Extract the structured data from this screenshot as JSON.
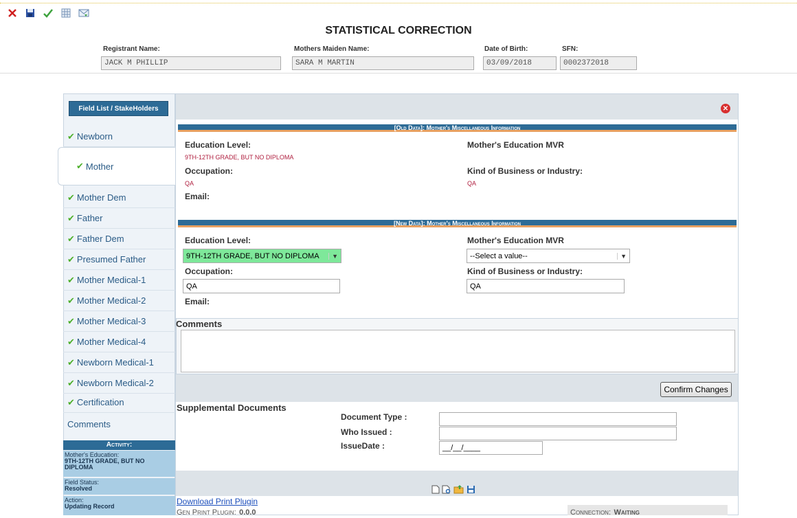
{
  "toolbar": {
    "icons": [
      "close-icon",
      "save-icon",
      "check-icon",
      "grid-icon",
      "email-icon"
    ]
  },
  "page_title": "STATISTICAL CORRECTION",
  "header": {
    "registrant_label": "Registrant Name:",
    "registrant_value": "JACK M PHILLIP",
    "maiden_label": "Mothers Maiden Name:",
    "maiden_value": "SARA M MARTIN",
    "dob_label": "Date of Birth:",
    "dob_value": "03/09/2018",
    "sfn_label": "SFN:",
    "sfn_value": "0002372018"
  },
  "sidebar": {
    "field_list_button": "Field List / StakeHolders",
    "items": [
      {
        "label": "Newborn",
        "checked": true
      },
      {
        "label": "Mother",
        "checked": true,
        "active": true
      },
      {
        "label": "Mother Dem",
        "checked": true
      },
      {
        "label": "Father",
        "checked": true
      },
      {
        "label": "Father Dem",
        "checked": true
      },
      {
        "label": "Presumed Father",
        "checked": true
      },
      {
        "label": "Mother Medical-1",
        "checked": true
      },
      {
        "label": "Mother Medical-2",
        "checked": true
      },
      {
        "label": "Mother Medical-3",
        "checked": true
      },
      {
        "label": "Mother Medical-4",
        "checked": true
      },
      {
        "label": "Newborn Medical-1",
        "checked": true
      },
      {
        "label": "Newborn Medical-2",
        "checked": true
      },
      {
        "label": "Certification",
        "checked": true
      },
      {
        "label": "Comments",
        "checked": false
      }
    ],
    "activity_header": "Activity:",
    "activity": [
      {
        "label": "Mother's Education:",
        "value": "9TH-12TH GRADE, BUT NO DIPLOMA"
      },
      {
        "label": "Field Status:",
        "value": "Resolved"
      },
      {
        "label": "Action:",
        "value": "Updating Record"
      }
    ]
  },
  "old_data": {
    "title": "[Old Data]: Mother's Miscellaneous Information",
    "education_label": "Education Level:",
    "education_value": "9TH-12TH GRADE, BUT NO DIPLOMA",
    "mvr_label": "Mother's Education MVR",
    "occupation_label": "Occupation:",
    "occupation_value": "QA",
    "business_label": "Kind of Business or Industry:",
    "business_value": "QA",
    "email_label": "Email:"
  },
  "new_data": {
    "title": "[New Data]: Mother's Miscellaneous Information",
    "education_label": "Education Level:",
    "education_value": "9TH-12TH GRADE, BUT NO DIPLOMA",
    "mvr_label": "Mother's Education MVR",
    "mvr_value": "--Select a value--",
    "occupation_label": "Occupation:",
    "occupation_value": "QA",
    "business_label": "Kind of Business or Industry:",
    "business_value": "QA",
    "email_label": "Email:"
  },
  "comments": {
    "title": "Comments",
    "value": ""
  },
  "confirm_button": "Confirm Changes",
  "supplemental": {
    "title": "Supplemental Documents",
    "doc_type_label": "Document Type :",
    "who_issued_label": "Who Issued :",
    "issue_date_label": "IssueDate :",
    "issue_date_value": "__/__/____"
  },
  "footer": {
    "download_link": "Download Print Plugin",
    "plugin_label": "Gen Print Plugin:",
    "plugin_version": "0.0.0",
    "connection_label": "Connection:",
    "connection_value": "Waiting",
    "doc_icons": [
      "new-document-icon",
      "search-document-icon",
      "open-folder-icon",
      "save-icon"
    ]
  },
  "colors": {
    "accent_blue": "#2d6b96",
    "check_green": "#4caf2a",
    "old_value_red": "#b02040",
    "highlight_green": "#7ee89a"
  }
}
